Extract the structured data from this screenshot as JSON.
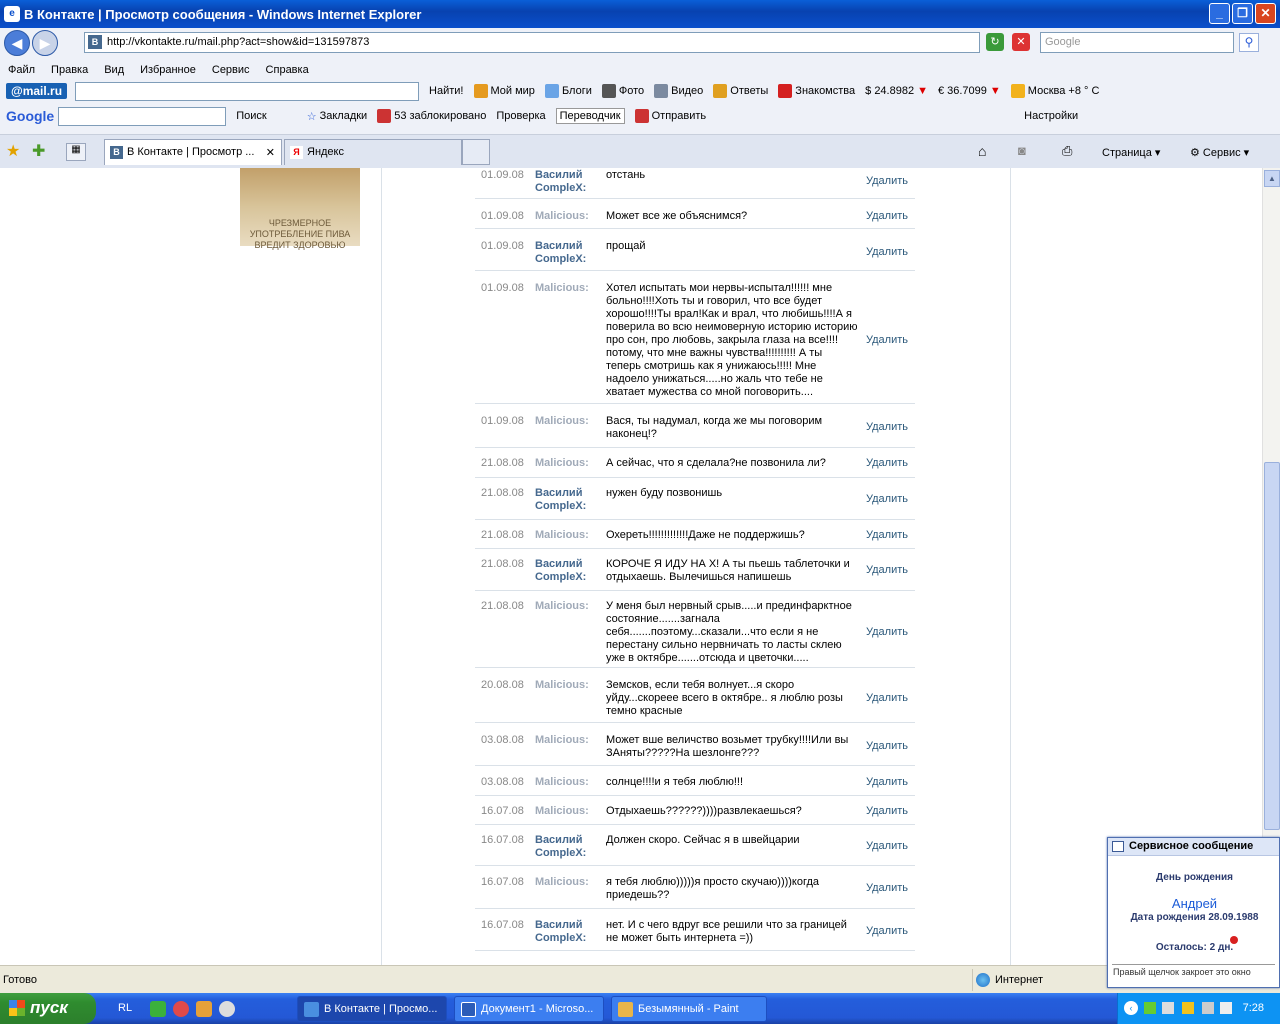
{
  "window": {
    "title": "В Контакте | Просмотр сообщения - Windows Internet Explorer"
  },
  "addressbar": {
    "url": "http://vkontakte.ru/mail.php?act=show&id=131597873",
    "site_icon": "В",
    "search_placeholder": "Google"
  },
  "menu": [
    "Файл",
    "Правка",
    "Вид",
    "Избранное",
    "Сервис",
    "Справка"
  ],
  "mailru_bar": {
    "logo": "@mail.ru",
    "find": "Найти!",
    "items": [
      "Мой мир",
      "Блоги",
      "Фото",
      "Видео",
      "Ответы",
      "Знакомства"
    ],
    "usd": "$ 24.8982",
    "eur": "€ 36.7099",
    "weather": "Москва +8 ° С"
  },
  "google_bar": {
    "logo": "Google",
    "search": "Поиск",
    "bookmarks": "Закладки",
    "blocked": "53 заблокировано",
    "spell": "Проверка",
    "translate": "Переводчик",
    "send": "Отправить",
    "settings": "Настройки"
  },
  "tabs": [
    {
      "label": "В Контакте | Просмотр ...",
      "icon": "В"
    },
    {
      "label": "Яндекс",
      "icon": "Я"
    }
  ],
  "cmdbar": {
    "page": "Страница",
    "tools": "Сервис"
  },
  "banner": {
    "text": "ЧРЕЗМЕРНОЕ УПОТРЕБЛЕНИЕ ПИВА ВРЕДИТ ЗДОРОВЬЮ"
  },
  "messages": [
    {
      "date": "01.09.08",
      "author": "Василий ComplеX:",
      "text": "отстань",
      "del": "Удалить",
      "self": true
    },
    {
      "date": "01.09.08",
      "author": "Malicious:",
      "text": "Может все же объяснимся?",
      "del": "Удалить",
      "self": false
    },
    {
      "date": "01.09.08",
      "author": "Василий ComplеX:",
      "text": "прощай",
      "del": "Удалить",
      "self": true
    },
    {
      "date": "01.09.08",
      "author": "Malicious:",
      "text": "Хотел испытать мои нервы-испытал!!!!!! мне больно!!!!Хоть ты и говорил, что все будет хорошо!!!!Ты врал!Как и врал, что любишь!!!!А я поверила во всю неимоверную историю историю про сон, про любовь, закрыла глаза на все!!!!потому, что мне важны чувства!!!!!!!!!! А ты теперь смотришь как я унижаюсь!!!!! Мне надоело унижаться.....но жаль что тебе не хватает мужества со мной поговорить....",
      "del": "Удалить",
      "self": false
    },
    {
      "date": "01.09.08",
      "author": "Malicious:",
      "text": "Вася, ты надумал, когда же мы поговорим наконец!?",
      "del": "Удалить",
      "self": false
    },
    {
      "date": "21.08.08",
      "author": "Malicious:",
      "text": "А сейчас, что я сделала?не позвонила ли?",
      "del": "Удалить",
      "self": false
    },
    {
      "date": "21.08.08",
      "author": "Василий ComplеX:",
      "text": "нужен буду позвонишь",
      "del": "Удалить",
      "self": true
    },
    {
      "date": "21.08.08",
      "author": "Malicious:",
      "text": "Охереть!!!!!!!!!!!!!Даже не поддержишь?",
      "del": "Удалить",
      "self": false
    },
    {
      "date": "21.08.08",
      "author": "Василий ComplеX:",
      "text": "КОРОЧЕ Я ИДУ НА Х! А ты пьешь таблеточки и отдыхаешь. Вылечишься напишешь",
      "del": "Удалить",
      "self": true
    },
    {
      "date": "21.08.08",
      "author": "Malicious:",
      "text": "У меня был нервный срыв.....и прединфарктное состояние.......загнала себя.......поэтому...сказали...что если я не перестану сильно нервничать то ласты склею уже в октябре.......отсюда и цветочки.....",
      "del": "Удалить",
      "self": false
    },
    {
      "date": "20.08.08",
      "author": "Malicious:",
      "text": "Земсков, если тебя волнует...я скоро уйду...скореее всего в октябре.. я люблю розы темно красные",
      "del": "Удалить",
      "self": false
    },
    {
      "date": "03.08.08",
      "author": "Malicious:",
      "text": "Может вше величство возьмет трубку!!!!Или вы ЗАняты?????На шезлонге???",
      "del": "Удалить",
      "self": false
    },
    {
      "date": "03.08.08",
      "author": "Malicious:",
      "text": "солнце!!!!и я тебя люблю!!!",
      "del": "Удалить",
      "self": false
    },
    {
      "date": "16.07.08",
      "author": "Malicious:",
      "text": "Отдыхаешь??????))))развлекаешься?",
      "del": "Удалить",
      "self": false
    },
    {
      "date": "16.07.08",
      "author": "Василий ComplеX:",
      "text": "Должен скоро. Сейчас я в швейцарии",
      "del": "Удалить",
      "self": true
    },
    {
      "date": "16.07.08",
      "author": "Malicious:",
      "text": "я тебя люблю)))))я просто скучаю))))когда приедешь??",
      "del": "Удалить",
      "self": false
    },
    {
      "date": "16.07.08",
      "author": "Василий ComplеX:",
      "text": "нет. И с чего вдруг все решили что за границей не может быть интернета =))",
      "del": "Удалить",
      "self": true
    }
  ],
  "statusbar": {
    "status": "Готово",
    "zone": "Интернет"
  },
  "taskbar": {
    "start": "пуск",
    "lang": "RL",
    "tasks": [
      "В Контакте | Просмо...",
      "Документ1 - Microso...",
      "Безымянный - Paint"
    ],
    "clock": "7:28"
  },
  "popup": {
    "title": "Сервисное сообщение",
    "heading": "День рождения",
    "name": "Андрей",
    "birth": "Дата рождения 28.09.1988",
    "left": "Осталось: 2 дн.",
    "footer": "Правый щелчок закроет это окно"
  }
}
